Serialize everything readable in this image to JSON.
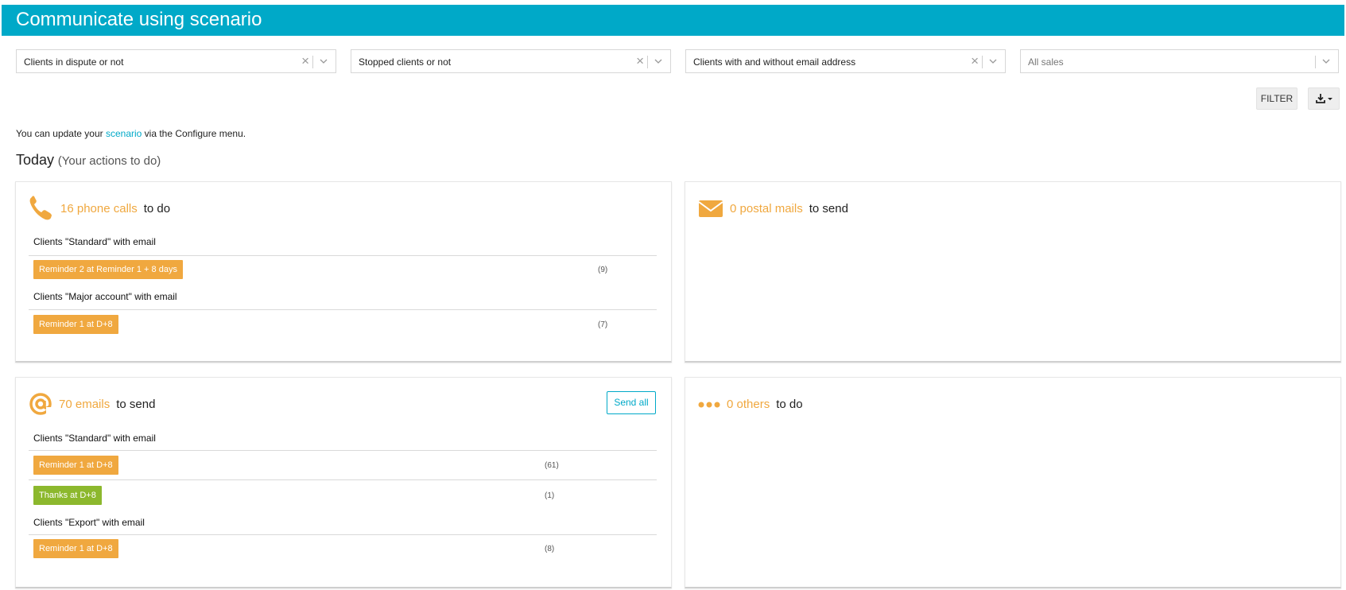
{
  "header": {
    "title": "Communicate using scenario"
  },
  "filters": {
    "dispute": "Clients in dispute or not",
    "stopped": "Stopped clients or not",
    "email": "Clients with and without email address",
    "sales": "All sales"
  },
  "toolbar": {
    "filter_label": "FILTER",
    "download_icon": "download-icon"
  },
  "hint": {
    "before": "You can update your ",
    "link": "scenario",
    "after": " via the Configure menu."
  },
  "today": {
    "title": "Today",
    "subtitle": "(Your actions to do)"
  },
  "colors": {
    "accent": "#00a9c8",
    "orange": "#f0a83f",
    "green": "#8cb82d"
  },
  "phone_card": {
    "icon": "phone-icon",
    "count_text": "16 phone calls",
    "rest_text": "to do",
    "groups": [
      {
        "title": "Clients \"Standard\" with email",
        "items": [
          {
            "label": "Reminder 2 at Reminder 1 + 8 days",
            "count": "(9)"
          }
        ]
      },
      {
        "title": "Clients \"Major account\" with email",
        "items": [
          {
            "label": "Reminder 1 at D+8",
            "count": "(7)"
          }
        ]
      }
    ]
  },
  "postal_card": {
    "icon": "envelope-icon",
    "count_text": "0 postal mails",
    "rest_text": "to send"
  },
  "email_card": {
    "icon": "at-sign-icon",
    "count_text": "70 emails",
    "rest_text": "to send",
    "send_all_label": "Send all",
    "groups": [
      {
        "title": "Clients \"Standard\" with email",
        "items": [
          {
            "label": "Reminder 1 at D+8",
            "count": "(61)"
          },
          {
            "label": "Thanks at D+8",
            "count": "(1)"
          }
        ]
      },
      {
        "title": "Clients \"Export\" with email",
        "items": [
          {
            "label": "Reminder 1 at D+8",
            "count": "(8)"
          }
        ]
      }
    ]
  },
  "others_card": {
    "icon": "more-dots-icon",
    "count_text": "0 others",
    "rest_text": "to do"
  }
}
